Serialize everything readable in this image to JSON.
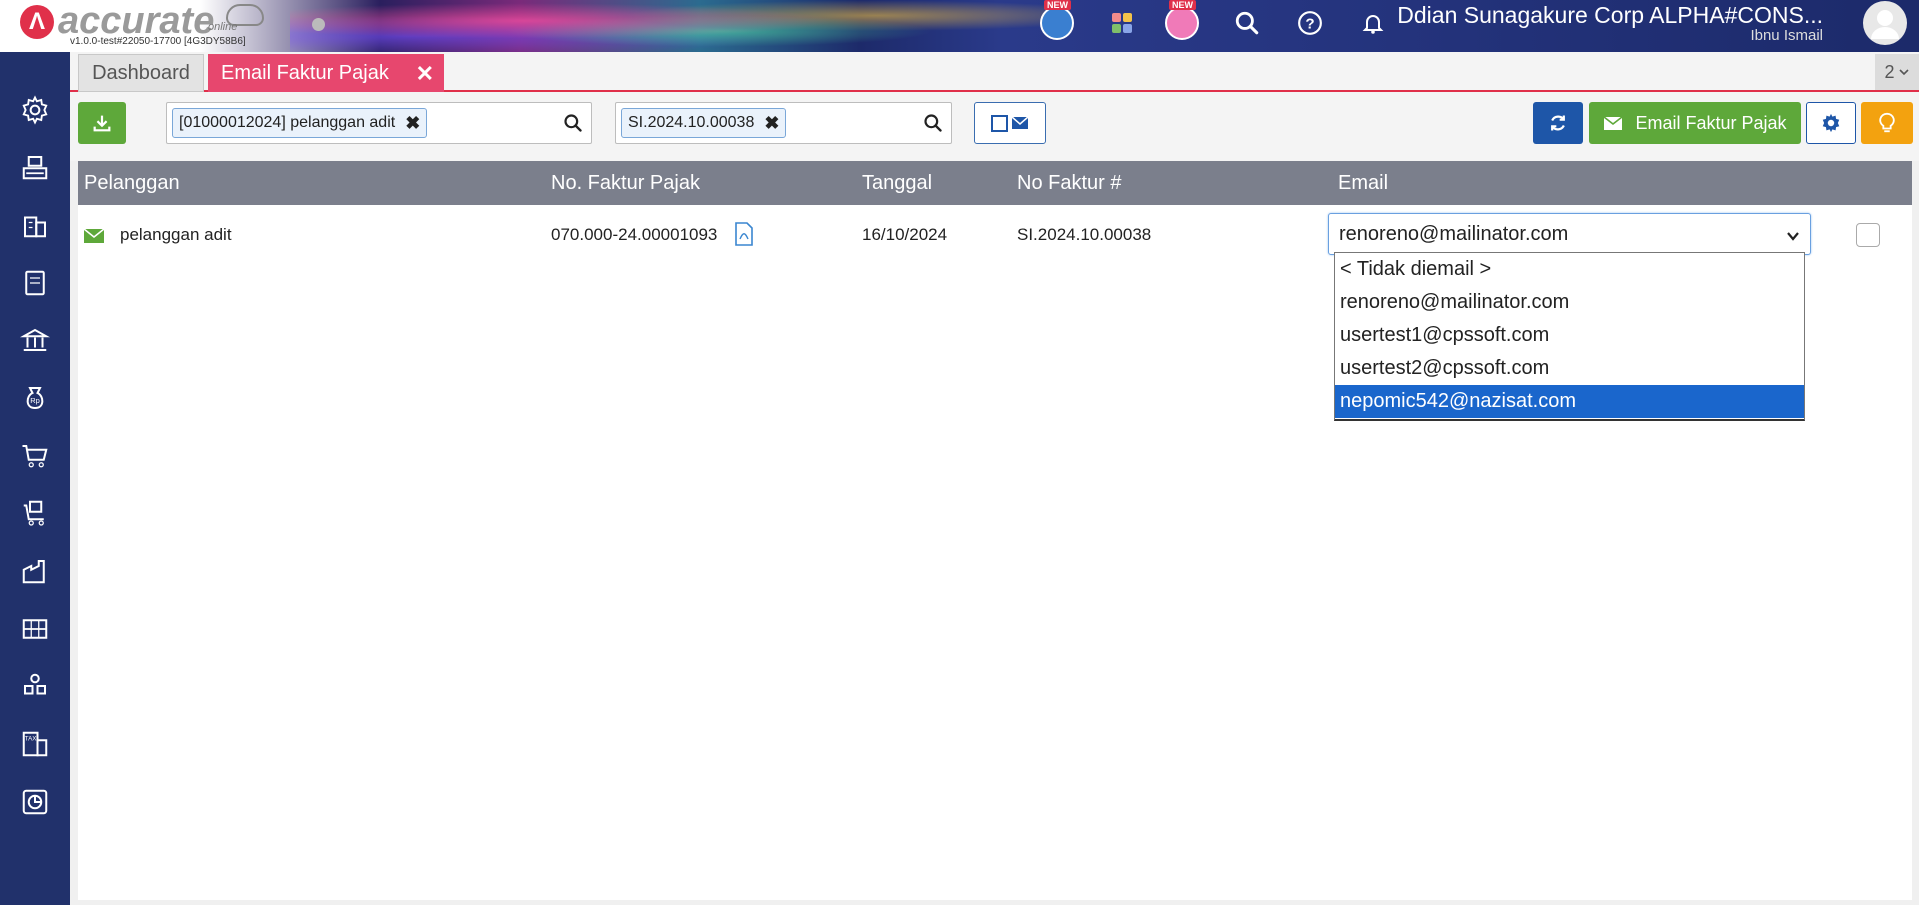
{
  "app": {
    "logo_text": "accurate",
    "logo_sub": "online",
    "version": "v1.0.0-test#22050-17700 [4G3DY58B6]",
    "new_badge": "NEW",
    "company": "Ddian Sunagakure Corp ALPHA#CONS...",
    "user": "Ibnu Ismail",
    "accent": "#e0304a",
    "sidebar_color": "#21316b"
  },
  "tabs": {
    "dashboard": "Dashboard",
    "active": "Email Faktur Pajak",
    "count": "2"
  },
  "toolbar": {
    "customer_filter": "[01000012024] pelanggan adit",
    "invoice_filter": "SI.2024.10.00038",
    "email_button": "Email Faktur Pajak"
  },
  "table": {
    "headers": [
      "Pelanggan",
      "No. Faktur Pajak",
      "Tanggal",
      "No Faktur #",
      "Email"
    ],
    "rows": [
      {
        "pelanggan": "pelanggan adit",
        "no_faktur_pajak": "070.000-24.00001093",
        "tanggal": "16/10/2024",
        "no_faktur": "SI.2024.10.00038",
        "email": "renoreno@mailinator.com"
      }
    ]
  },
  "email_options": [
    "< Tidak diemail >",
    "renoreno@mailinator.com",
    "usertest1@cpssoft.com",
    "usertest2@cpssoft.com",
    "nepomic542@nazisat.com"
  ],
  "email_highlighted": "nepomic542@nazisat.com"
}
